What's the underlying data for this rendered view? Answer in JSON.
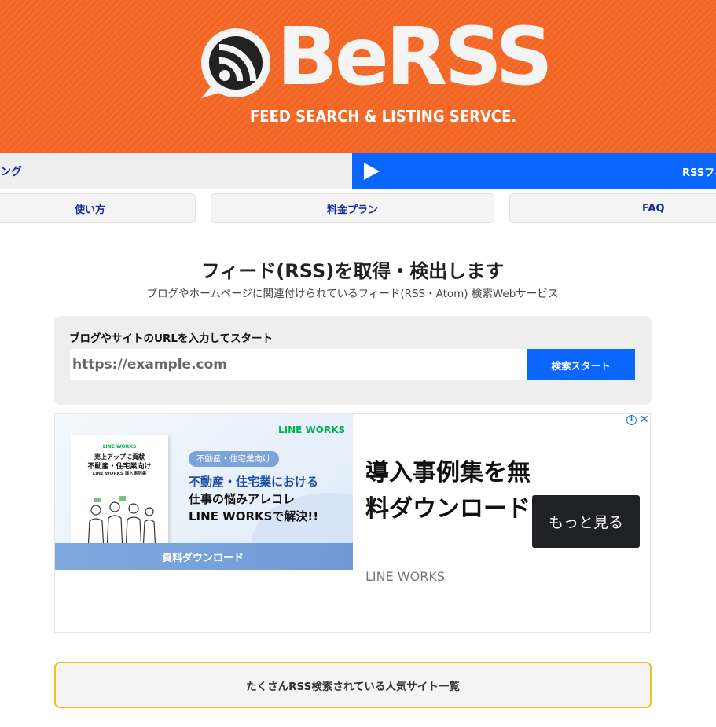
{
  "header": {
    "logo_text": "BeRSS",
    "tagline": "FEED SEARCH & LISTING SERVCE.",
    "background_color": "#f26522"
  },
  "ticker": {
    "left_text": "ング",
    "right_text": "RSSフィ",
    "right_icon": "play-icon",
    "right_color": "#0a66ff"
  },
  "nav": {
    "items": [
      {
        "label": "使い方"
      },
      {
        "label": "料金プラン"
      },
      {
        "label": "FAQ"
      }
    ]
  },
  "main": {
    "title": "フィード(RSS)を取得・検出します",
    "subtitle": "ブログやホームページに関連付けられているフィード(RSS・Atom) 検索Webサービス"
  },
  "search": {
    "label": "ブログやサイトのURLを入力してスタート",
    "placeholder": "https://example.com",
    "value": "",
    "button_label": "検索スタート",
    "button_color": "#0a66ff"
  },
  "ad": {
    "brand_small": "LINE WORKS",
    "book_brand": "LINE WORKS",
    "book_line1": "売上アップに貢献",
    "book_line2": "不動産・住宅業向け",
    "book_line3": "LINE WORKS 導入事例集",
    "tag": "不動産・住宅業向け",
    "headline_1": "不動産・住宅業における",
    "headline_2": "仕事の悩みアレコレ",
    "headline_3": "LINE WORKSで解決!!",
    "download_label": "資料ダウンロード",
    "main_headline": "導入事例集を無料ダウンロード",
    "advertiser": "LINE WORKS",
    "cta_label": "もっと見る",
    "info_icon": "i",
    "close_icon": "✕"
  },
  "popular": {
    "label": "たくさんRSS検索されている人気サイト一覧",
    "border_color": "#f0c21a"
  }
}
